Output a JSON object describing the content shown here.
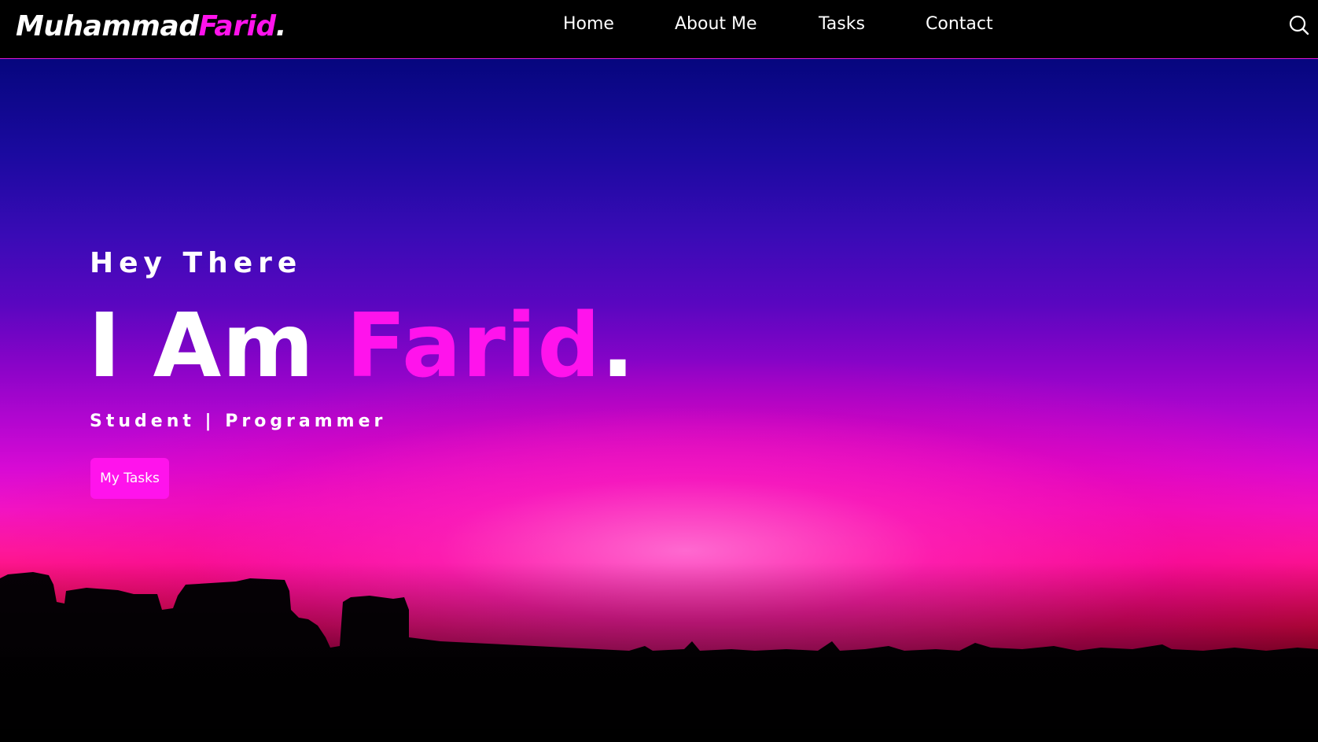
{
  "header": {
    "logo": {
      "first": "Muhammad",
      "accent": "Farid",
      "dot": "."
    },
    "nav": [
      {
        "label": "Home"
      },
      {
        "label": "About Me"
      },
      {
        "label": "Tasks"
      },
      {
        "label": "Contact"
      }
    ],
    "search_icon": "search-icon"
  },
  "hero": {
    "greeting": "Hey There",
    "title_prefix": "I Am ",
    "title_name": "Farid",
    "title_dot": ".",
    "subtitle": "Student | Programmer",
    "cta_label": "My Tasks",
    "background": "sunset-city-skyline"
  },
  "colors": {
    "accent": "#ff13ec",
    "navbar_bg": "#000000",
    "text": "#ffffff"
  }
}
